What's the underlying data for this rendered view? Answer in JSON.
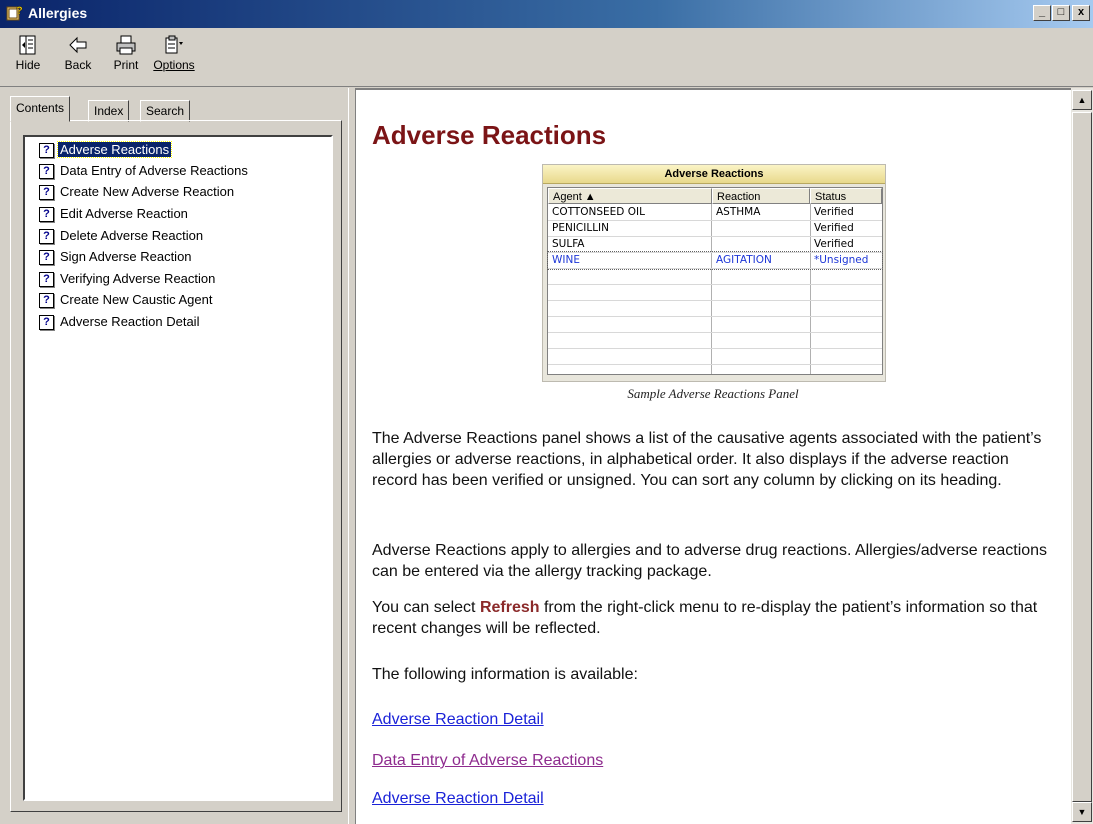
{
  "window": {
    "title": "Allergies",
    "minimize_label": "_",
    "maximize_label": "□",
    "close_label": "x"
  },
  "toolbar": {
    "hide_label": "Hide",
    "back_label": "Back",
    "print_label": "Print",
    "options_label": "Options"
  },
  "tabs": {
    "contents": "Contents",
    "index": "Index",
    "search": "Search"
  },
  "tree": {
    "items": [
      {
        "label": "Adverse Reactions",
        "selected": true
      },
      {
        "label": "Data Entry of Adverse Reactions"
      },
      {
        "label": "Create New Adverse Reaction"
      },
      {
        "label": "Edit Adverse Reaction"
      },
      {
        "label": "Delete Adverse Reaction"
      },
      {
        "label": "Sign Adverse Reaction"
      },
      {
        "label": "Verifying Adverse Reaction"
      },
      {
        "label": "Create New Caustic Agent"
      },
      {
        "label": "Adverse Reaction Detail"
      }
    ]
  },
  "content": {
    "heading": "Adverse Reactions",
    "panel": {
      "title": "Adverse Reactions",
      "headers": {
        "agent": "Agent ▲",
        "reaction": "Reaction",
        "status": "Status"
      },
      "rows": [
        {
          "agent": "COTTONSEED OIL",
          "reaction": "ASTHMA",
          "status": "Verified"
        },
        {
          "agent": "PENICILLIN",
          "reaction": "",
          "status": "Verified"
        },
        {
          "agent": "SULFA",
          "reaction": "",
          "status": "Verified"
        },
        {
          "agent": "WINE",
          "reaction": "AGITATION",
          "status": "*Unsigned"
        }
      ],
      "caption": "Sample Adverse Reactions Panel"
    },
    "para1": "The Adverse Reactions panel shows a list of the causative agents associated with the patient’s allergies or adverse reactions, in alphabetical order. It also displays if the adverse reaction record has been verified or unsigned. You can sort any column by clicking on its heading.",
    "para2": "Adverse Reactions apply to allergies and to adverse drug reactions. Allergies/adverse reactions can be entered via the allergy tracking package.",
    "para3_before": "You can select ",
    "para3_keyword": "Refresh",
    "para3_after": " from the right-click menu to re-display the patient’s information so that recent changes will be reflected.",
    "para4": "The following information is available:",
    "links": [
      {
        "label": "Adverse Reaction Detail",
        "visited": false
      },
      {
        "label": "Data Entry of Adverse Reactions",
        "visited": true
      },
      {
        "label": "Adverse Reaction Detail",
        "visited": false
      }
    ]
  },
  "scrollbar": {
    "up_arrow": "▲",
    "down_arrow": "▼"
  },
  "colors": {
    "title_bar": "#0a246a",
    "heading": "#7b1416",
    "link": "#1a22d8",
    "visited_link": "#8e2b8e",
    "selection": "#0a246a"
  }
}
